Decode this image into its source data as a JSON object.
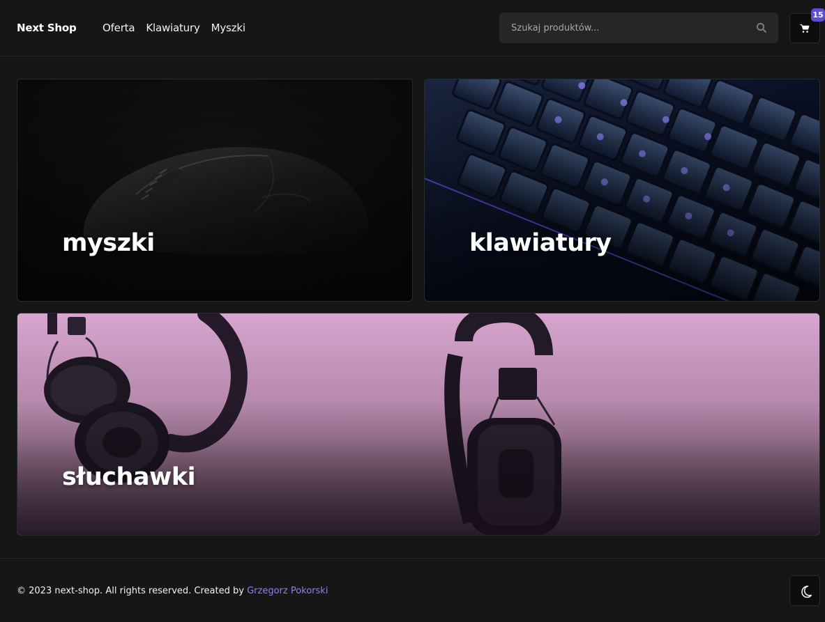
{
  "header": {
    "logo": "Next Shop",
    "nav": [
      "Oferta",
      "Klawiatury",
      "Myszki"
    ],
    "search_placeholder": "Szukaj produktów...",
    "cart_count": "15",
    "icons": {
      "search": "search-icon",
      "cart": "cart-icon"
    }
  },
  "categories": [
    {
      "label": "myszki"
    },
    {
      "label": "klawiatury"
    },
    {
      "label": "słuchawki"
    }
  ],
  "footer": {
    "copyright": "© 2023 next-shop. All rights reserved. Created by",
    "author": "Grzegorz Pokorski",
    "theme_icon": "moon-icon"
  },
  "colors": {
    "background": "#161616",
    "accent": "#5b4fd6",
    "link": "#8b82f2"
  }
}
